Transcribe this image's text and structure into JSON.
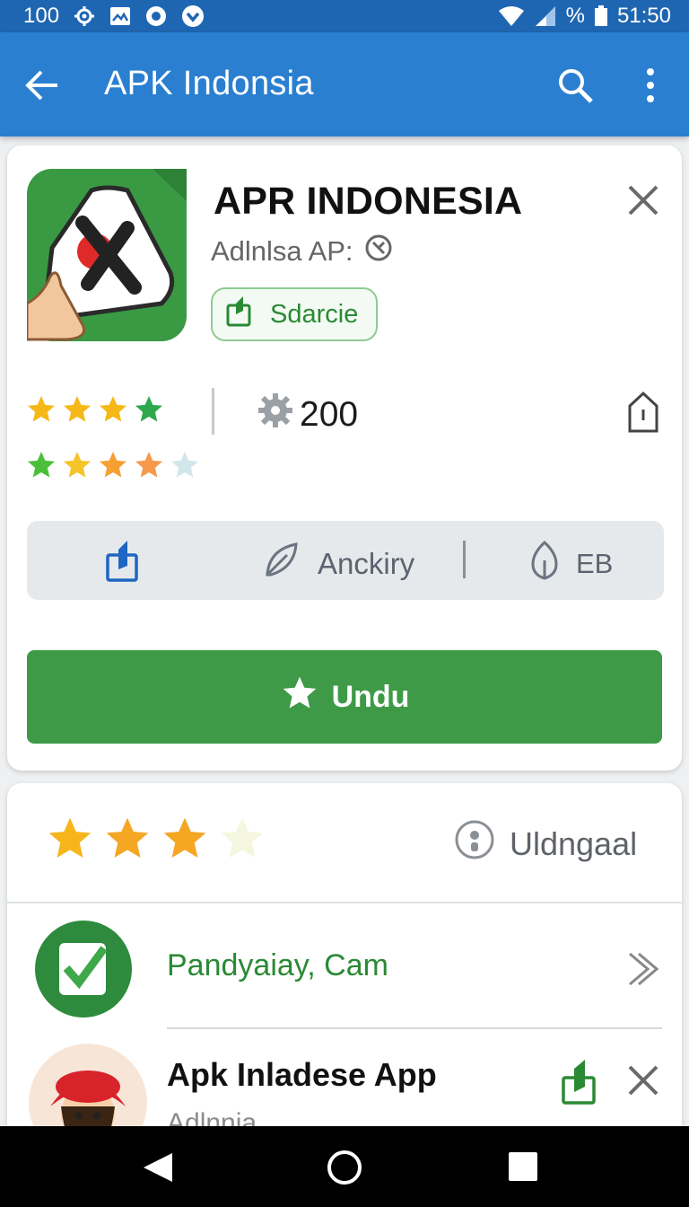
{
  "status_bar": {
    "battery_level": "100",
    "battery_percent_label": "%",
    "time": "51:50",
    "icons": [
      "settings-icon",
      "image-icon",
      "record-icon",
      "download-circle-icon",
      "wifi-icon",
      "signal-icon",
      "battery-icon"
    ]
  },
  "app_bar": {
    "title": "APK Indonsia",
    "icons": [
      "back-arrow-icon",
      "search-icon",
      "more-vert-icon"
    ]
  },
  "app_card": {
    "name": "APR INDONESIA",
    "developer": "Adlnlsa AP:",
    "share_chip_label": "Sdarcie",
    "downloads": "200",
    "category": "Anckiry",
    "size": "EB",
    "download_button": "Undu",
    "rating_row_1": [
      "#f5b818",
      "#f5b818",
      "#f5b818",
      "#2ea84c"
    ],
    "rating_row_2": [
      "#4bbf3a",
      "#f5c42a",
      "#f5a033",
      "#f59a4a",
      "#d2e6ec"
    ]
  },
  "reviews_card": {
    "rating_colors": [
      "#f7b51c",
      "#f5a623",
      "#f5a623",
      "#f4f6df"
    ],
    "user_label": "Uldngaal",
    "items": [
      {
        "label": "Pandyaiay, Cam",
        "icon": "verified-check-icon"
      },
      {
        "title": "Apk Inladese App",
        "subtitle": "Adlnnia",
        "icon": "avatar-icon"
      }
    ]
  },
  "colors": {
    "app_bar": "#2a7fd0",
    "status_bar": "#1f66b2",
    "primary_green": "#3f9a48",
    "accent_green": "#2a8a34"
  }
}
